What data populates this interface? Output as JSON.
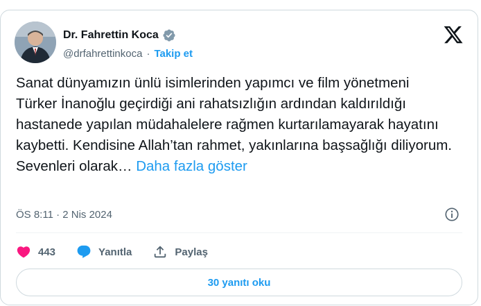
{
  "author": {
    "name": "Dr. Fahrettin Koca",
    "handle": "@drfahrettinkoca",
    "separator": "·",
    "follow_label": "Takip et"
  },
  "tweet": {
    "text": "Sanat dünyamızın ünlü isimlerinden yapımcı ve film yönetmeni Türker İnanoğlu geçirdiği ani rahatsızlığın ardından kaldırıldığı hastanede yapılan müdahalelere rağmen kurtarılamayarak hayatını kaybetti. Kendisine Allah’tan rahmet, yakınlarına başsağlığı diliyorum. Sevenleri olarak… ",
    "show_more_label": "Daha fazla göster",
    "timestamp": "ÖS 8:11 · 2 Nis 2024"
  },
  "actions": {
    "likes_count": "443",
    "reply_label": "Yanıtla",
    "share_label": "Paylaş"
  },
  "read_replies_label": "30 yanıtı oku",
  "colors": {
    "accent": "#1d9bf0",
    "like": "#f91880",
    "verified": "#829aab",
    "text": "#0f1419",
    "muted": "#536471"
  },
  "icons": [
    "verified-badge-icon",
    "x-logo-icon",
    "info-icon",
    "heart-icon",
    "reply-bubble-icon",
    "share-icon"
  ]
}
